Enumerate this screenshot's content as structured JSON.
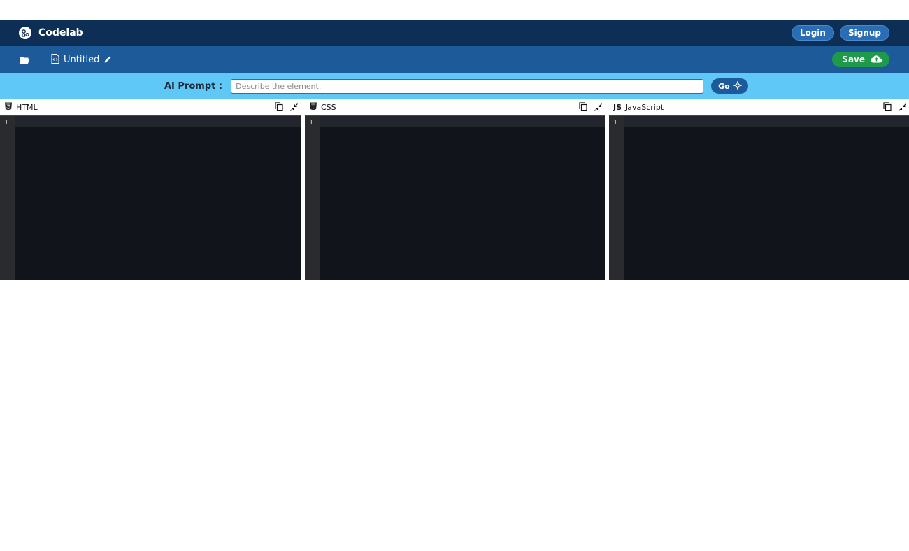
{
  "app": {
    "title": "Codelab"
  },
  "auth": {
    "login_label": "Login",
    "signup_label": "Signup"
  },
  "toolbar": {
    "file_name": "Untitled",
    "save_label": "Save"
  },
  "prompt": {
    "label": "AI Prompt :",
    "placeholder": "Describe the element.",
    "value": "",
    "go_label": "Go"
  },
  "editors": [
    {
      "title": "HTML",
      "line_number": "1",
      "icon": "html5-icon"
    },
    {
      "title": "CSS",
      "line_number": "1",
      "icon": "css3-icon"
    },
    {
      "title": "JavaScript",
      "line_number": "1",
      "icon": "js-icon",
      "badge": "JS"
    }
  ],
  "colors": {
    "navbar": "#0d2e55",
    "toolbar": "#1d5a9a",
    "prompt_bar": "#5fc8f7",
    "save": "#1e9a4a",
    "editor_bg": "#11141b"
  }
}
